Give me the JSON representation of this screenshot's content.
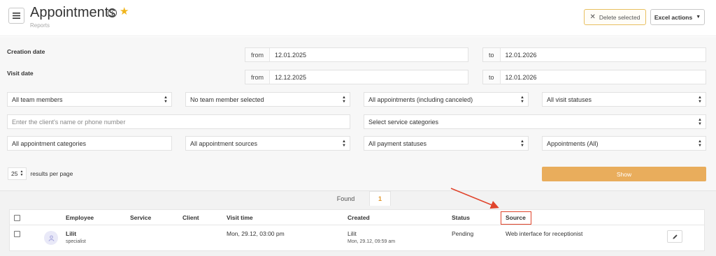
{
  "header": {
    "title": "Appointments",
    "subtitle": "Reports",
    "info_glyph": "i",
    "star_glyph": "★",
    "delete_label": "Delete selected",
    "excel_label": "Excel actions"
  },
  "filters": {
    "creation_date": {
      "label": "Creation date",
      "from_prefix": "from",
      "from_value": "12.01.2025",
      "to_prefix": "to",
      "to_value": "12.01.2026"
    },
    "visit_date": {
      "label": "Visit date",
      "from_prefix": "from",
      "from_value": "12.12.2025",
      "to_prefix": "to",
      "to_value": "12.01.2026"
    },
    "team_members": "All team members",
    "team_member_selected": "No team member selected",
    "appointments_filter": "All appointments (including canceled)",
    "visit_statuses": "All visit statuses",
    "client_placeholder": "Enter the client's name or phone number",
    "service_categories": "Select service categories",
    "appointment_categories": "All appointment categories",
    "appointment_sources": "All appointment sources",
    "payment_statuses": "All payment statuses",
    "appointments_all": "Appointments (All)",
    "per_page_value": "25",
    "per_page_label": "results per page",
    "show_label": "Show"
  },
  "found": {
    "label": "Found",
    "count": "1"
  },
  "table": {
    "headers": {
      "employee": "Employee",
      "service": "Service",
      "client": "Client",
      "visit_time": "Visit time",
      "created": "Created",
      "status": "Status",
      "source": "Source"
    },
    "rows": [
      {
        "employee_name": "Lilit",
        "employee_role": "specialist",
        "service": "",
        "client": "",
        "visit_time": "Mon, 29.12, 03:00 pm",
        "created_by": "Lilit",
        "created_at": "Mon, 29.12, 09:59 am",
        "status": "Pending",
        "source": "Web interface for receptionist"
      }
    ]
  },
  "colors": {
    "accent": "#e9ad5c",
    "highlight": "#e0442c",
    "star": "#f0b51c"
  },
  "icons": [
    "menu-icon",
    "info-icon",
    "star-icon",
    "close-icon",
    "chevron-down-icon",
    "select-arrows-icon",
    "avatar-icon",
    "edit-icon",
    "annotation-arrow"
  ]
}
